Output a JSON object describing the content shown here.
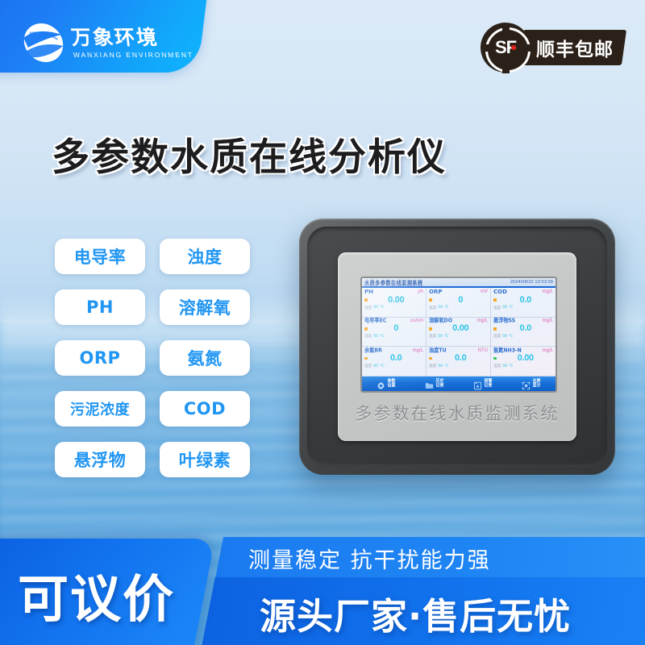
{
  "brand": {
    "logo_cn": "万象环境",
    "logo_en": "WANXIANG ENVIRONMENT",
    "logo_icon": "globe-swoosh-logo"
  },
  "shipping_badge": {
    "mark_letters": "SF",
    "label": "顺丰包邮",
    "icon": "sf-express-icon"
  },
  "main_title": "多参数水质在线分析仪",
  "feature_tags": [
    {
      "label": "电导率"
    },
    {
      "label": "浊度"
    },
    {
      "label": "PH"
    },
    {
      "label": "溶解氧"
    },
    {
      "label": "ORP"
    },
    {
      "label": "氨氮"
    },
    {
      "label": "污泥浓度"
    },
    {
      "label": "COD"
    },
    {
      "label": "悬浮物"
    },
    {
      "label": "叶绿素"
    }
  ],
  "device": {
    "panel_label": "多参数在线水质监测系统",
    "screen": {
      "title": "水质多参数在线监测系统",
      "timestamp": "2024/08/22 10:53:09",
      "temp_label": "温度",
      "temp_value": "00",
      "temp_unit": "℃",
      "cells": [
        {
          "name": "PH",
          "name_style": "en",
          "unit": "ph",
          "value": "0.00",
          "status": "orange"
        },
        {
          "name": "ORP",
          "name_style": "en",
          "unit": "mV",
          "value": "0",
          "status": "orange"
        },
        {
          "name": "COD",
          "name_style": "en",
          "unit": "mg/L",
          "value": "0.0",
          "status": "orange"
        },
        {
          "name": "电导率EC",
          "name_style": "cn",
          "unit": "us/cm",
          "value": "0",
          "status": "orange"
        },
        {
          "name": "溶解氧DO",
          "name_style": "cn",
          "unit": "mg/L",
          "value": "0.00",
          "status": "orange"
        },
        {
          "name": "悬浮物SS",
          "name_style": "cn",
          "unit": "mg/L",
          "value": "0.0",
          "status": "orange"
        },
        {
          "name": "余氯BR",
          "name_style": "cn",
          "unit": "mg/L",
          "value": "0.0",
          "status": "orange"
        },
        {
          "name": "浊度TU",
          "name_style": "cn",
          "unit": "NTU",
          "value": "0.0",
          "status": "orange"
        },
        {
          "name": "氨氮NH3-N",
          "name_style": "cn",
          "unit": "mg/L",
          "value": "0.00",
          "status": "green"
        }
      ],
      "toolbar": [
        {
          "label": "参数\n设置",
          "icon": "gear-icon"
        },
        {
          "label": "历史\n记录",
          "icon": "folder-icon"
        },
        {
          "label": "报警\n记录",
          "icon": "document-alert-icon"
        },
        {
          "label": "全屏\n显示",
          "icon": "fullscreen-icon"
        }
      ]
    }
  },
  "promo": {
    "price_text": "可议价",
    "subtitle": "测量稳定  抗干扰能力强",
    "headline": "源头厂家·售后无忧"
  },
  "colors": {
    "brand_blue": "#1a7bf0",
    "tag_blue": "#2196f3",
    "screen_value_cyan": "#2ec4e8",
    "screen_unit_pink": "#e05fb4",
    "status_orange": "#f5a623",
    "status_green": "#35c75a",
    "sf_dark": "#2b2119",
    "sf_red": "#e2231a"
  }
}
